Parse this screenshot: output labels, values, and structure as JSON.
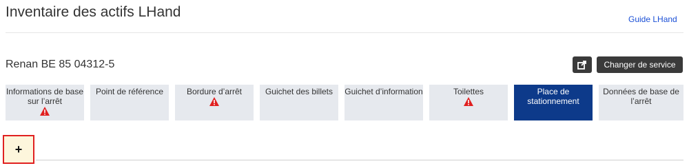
{
  "header": {
    "title": "Inventaire des actifs LHand",
    "guide_link": "Guide LHand"
  },
  "stop": {
    "name": "Renan BE 85 04312-5"
  },
  "actions": {
    "export_icon": "external-link-icon",
    "change_service_label": "Changer de service"
  },
  "tabs": [
    {
      "label": "Informations de base sur l’arrêt",
      "warning": true,
      "active": false
    },
    {
      "label": "Point de référence",
      "warning": false,
      "active": false
    },
    {
      "label": "Bordure d’arrêt",
      "warning": true,
      "active": false
    },
    {
      "label": "Guichet des billets",
      "warning": false,
      "active": false
    },
    {
      "label": "Guichet d’information",
      "warning": false,
      "active": false
    },
    {
      "label": "Toilettes",
      "warning": true,
      "active": false
    },
    {
      "label": "Place de stationnement",
      "warning": false,
      "active": true
    },
    {
      "label": "Données de base de l’arrêt",
      "warning": false,
      "active": false
    }
  ],
  "add_button": {
    "label": "+"
  },
  "colors": {
    "active_tab": "#0d3a8a",
    "tab_bg": "#e6e9ee",
    "warning": "#e02020",
    "dark_button": "#3a3a3a"
  }
}
